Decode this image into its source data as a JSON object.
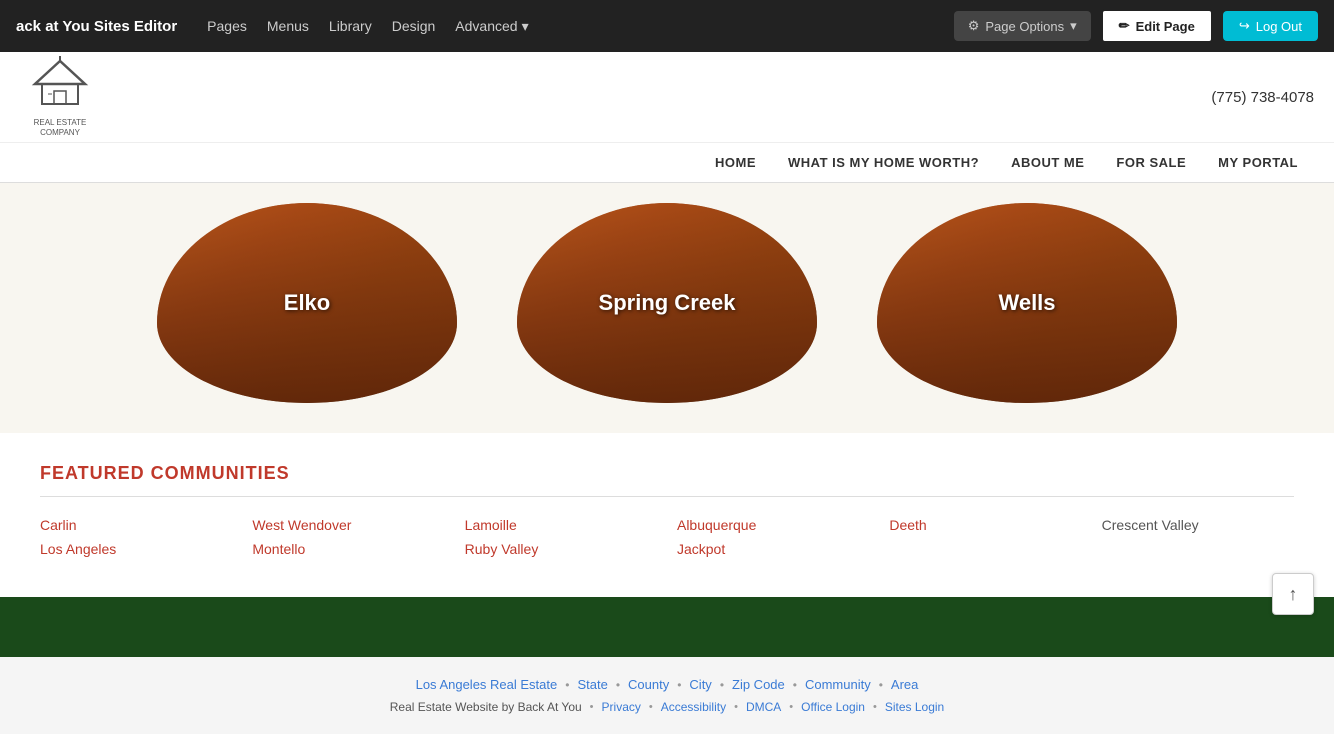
{
  "editor_bar": {
    "site_title": "ack at You Sites Editor",
    "nav_items": [
      {
        "label": "Pages",
        "name": "pages"
      },
      {
        "label": "Menus",
        "name": "menus"
      },
      {
        "label": "Library",
        "name": "library"
      },
      {
        "label": "Design",
        "name": "design"
      },
      {
        "label": "Advanced",
        "name": "advanced"
      }
    ],
    "page_options_label": "Page Options",
    "edit_page_label": "Edit Page",
    "logout_label": "Log Out"
  },
  "site_header": {
    "logo_line1": "REAL ESTATE COMPANY",
    "phone": "(775) 738-4078"
  },
  "site_nav": {
    "items": [
      {
        "label": "HOME"
      },
      {
        "label": "WHAT IS MY HOME WORTH?"
      },
      {
        "label": "ABOUT ME"
      },
      {
        "label": "FOR SALE"
      },
      {
        "label": "MY PORTAL"
      }
    ]
  },
  "city_circles": [
    {
      "label": "Elko"
    },
    {
      "label": "Spring Creek"
    },
    {
      "label": "Wells"
    }
  ],
  "featured_communities": {
    "title": "FEATURED COMMUNITIES",
    "items": [
      {
        "label": "Carlin",
        "style": "link"
      },
      {
        "label": "West Wendover",
        "style": "link"
      },
      {
        "label": "Lamoille",
        "style": "link"
      },
      {
        "label": "Albuquerque",
        "style": "link"
      },
      {
        "label": "Deeth",
        "style": "link"
      },
      {
        "label": "Crescent Valley",
        "style": "dark"
      },
      {
        "label": "Los Angeles",
        "style": "link"
      },
      {
        "label": "Montello",
        "style": "link"
      },
      {
        "label": "Ruby Valley",
        "style": "link"
      },
      {
        "label": "Jackpot",
        "style": "link"
      },
      {
        "label": "",
        "style": "dark"
      },
      {
        "label": "",
        "style": "dark"
      }
    ]
  },
  "footer": {
    "links_row": [
      {
        "label": "Los Angeles Real Estate"
      },
      {
        "label": "State"
      },
      {
        "label": "County"
      },
      {
        "label": "City"
      },
      {
        "label": "Zip Code"
      },
      {
        "label": "Community"
      },
      {
        "label": "Area"
      }
    ],
    "bottom_row": [
      {
        "label": "Real Estate Website by Back At You",
        "type": "plain"
      },
      {
        "label": "Privacy"
      },
      {
        "label": "Accessibility"
      },
      {
        "label": "DMCA"
      },
      {
        "label": "Office Login"
      },
      {
        "label": "Sites Login"
      }
    ]
  },
  "scroll_top": "↑"
}
